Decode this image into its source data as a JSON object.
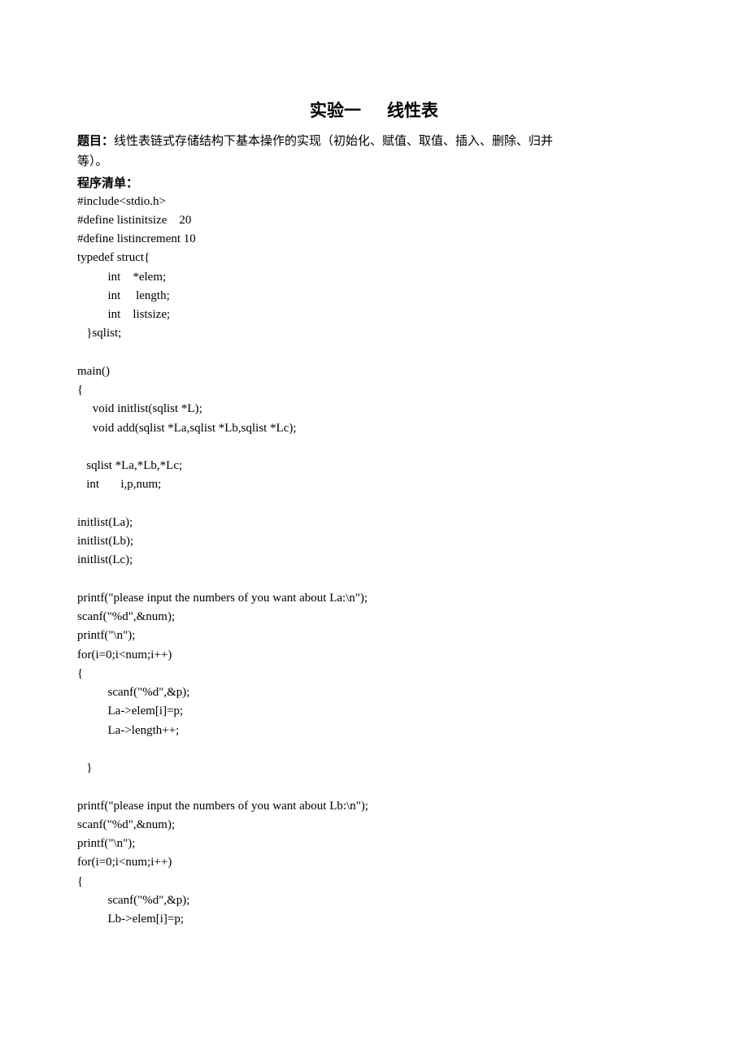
{
  "title_left": "实验一",
  "title_right": "线性表",
  "topic_label": "题目：",
  "topic_text_line1": "线性表链式存储结构下基本操作的实现（初始化、赋值、取值、插入、删除、归并",
  "topic_text_line2": "等）。",
  "listing_label": "程序清单：",
  "code": "#include<stdio.h>\n#define listinitsize    20\n#define listincrement 10\ntypedef struct{\n          int    *elem;\n          int     length;\n          int    listsize;\n   }sqlist;\n\nmain()\n{\n     void initlist(sqlist *L);\n     void add(sqlist *La,sqlist *Lb,sqlist *Lc);\n\n   sqlist *La,*Lb,*Lc;\n   int       i,p,num;\n\ninitlist(La);\ninitlist(Lb);\ninitlist(Lc);\n\nprintf(\"please input the numbers of you want about La:\\n\");\nscanf(\"%d\",&num);\nprintf(\"\\n\");\nfor(i=0;i<num;i++)\n{\n          scanf(\"%d\",&p);\n          La->elem[i]=p;\n          La->length++;\n\n   }\n\nprintf(\"please input the numbers of you want about Lb:\\n\");\nscanf(\"%d\",&num);\nprintf(\"\\n\");\nfor(i=0;i<num;i++)\n{\n          scanf(\"%d\",&p);\n          Lb->elem[i]=p;"
}
